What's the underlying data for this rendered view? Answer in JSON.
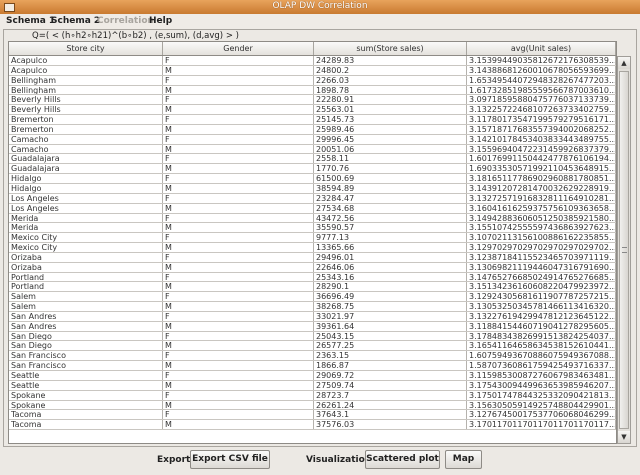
{
  "window": {
    "title": "OLAP DW Correlation"
  },
  "menu": {
    "items": [
      "Schema 1",
      "Schema 2",
      "Correlation",
      "Help"
    ]
  },
  "query": "Q=( < (h∘h2∘h21)^(b∘b2) , (e,sum), (d,avg) > )",
  "table": {
    "columns": [
      "Store city",
      "Gender",
      "sum(Store sales)",
      "avg(Unit sales)"
    ],
    "rows": [
      [
        "Acapulco",
        "F",
        "24289.83",
        "3.15399449035812672176308539..."
      ],
      [
        "Acapulco",
        "M",
        "24800.2",
        "3.14388681260010678056593699..."
      ],
      [
        "Bellingham",
        "F",
        "2266.03",
        "1.65349544072948328267477203..."
      ],
      [
        "Bellingham",
        "M",
        "1898.78",
        "1.61732851985559566787003610..."
      ],
      [
        "Beverly Hills",
        "F",
        "22280.91",
        "3.09718595880475776037133739..."
      ],
      [
        "Beverly Hills",
        "M",
        "25563.01",
        "3.13225722468107263733402759..."
      ],
      [
        "Bremerton",
        "F",
        "25145.73",
        "3.11780173547199579279516171..."
      ],
      [
        "Bremerton",
        "M",
        "25989.46",
        "3.15718717683557394002068252..."
      ],
      [
        "Camacho",
        "F",
        "29996.45",
        "3.14210178453403833443489755..."
      ],
      [
        "Camacho",
        "M",
        "20051.06",
        "3.15596940472231459926837379..."
      ],
      [
        "Guadalajara",
        "F",
        "2558.11",
        "1.60176991150442477876106194..."
      ],
      [
        "Guadalajara",
        "M",
        "1770.76",
        "1.69033530571992110453648915..."
      ],
      [
        "Hidalgo",
        "F",
        "61500.69",
        "3.18165117786902960881780851..."
      ],
      [
        "Hidalgo",
        "M",
        "38594.89",
        "3.14391207281470032629228919..."
      ],
      [
        "Los Angeles",
        "F",
        "23284.47",
        "3.13272571916832811164910281..."
      ],
      [
        "Los Angeles",
        "M",
        "27534.68",
        "3.16041616259375756109363658..."
      ],
      [
        "Merida",
        "F",
        "43472.56",
        "3.14942883606051250385921580..."
      ],
      [
        "Merida",
        "M",
        "35590.57",
        "3.15510742555597436863927623..."
      ],
      [
        "Mexico City",
        "F",
        "9777.13",
        "3.10702113156100886162235855..."
      ],
      [
        "Mexico City",
        "M",
        "13365.66",
        "3.12970297029702970297029702..."
      ],
      [
        "Orizaba",
        "F",
        "29496.01",
        "3.12387184115523465703971119..."
      ],
      [
        "Orizaba",
        "M",
        "22646.06",
        "3.13069821119446047316791690..."
      ],
      [
        "Portland",
        "F",
        "25343.16",
        "3.14765276685024914765276685..."
      ],
      [
        "Portland",
        "M",
        "28290.1",
        "3.15134236160608220479923972..."
      ],
      [
        "Salem",
        "F",
        "36696.49",
        "3.12924305681611907787257215..."
      ],
      [
        "Salem",
        "M",
        "38268.75",
        "3.13053250345781466113416320..."
      ],
      [
        "San Andres",
        "F",
        "33021.97",
        "3.13227619429947812123645122..."
      ],
      [
        "San Andres",
        "M",
        "39361.64",
        "3.11884154460719041278295605..."
      ],
      [
        "San Diego",
        "F",
        "25043.15",
        "3.17848343826991513824254037..."
      ],
      [
        "San Diego",
        "M",
        "26577.25",
        "3.16541164658634538152610441..."
      ],
      [
        "San Francisco",
        "F",
        "2363.15",
        "1.60759493670886075949367088..."
      ],
      [
        "San Francisco",
        "M",
        "1866.87",
        "1.58707360861759425493716337..."
      ],
      [
        "Seattle",
        "F",
        "29069.72",
        "3.11598530087276067983463481..."
      ],
      [
        "Seattle",
        "M",
        "27509.74",
        "3.17543009449963653985946207..."
      ],
      [
        "Spokane",
        "F",
        "28723.7",
        "3.17501747844325332090421813..."
      ],
      [
        "Spokane",
        "M",
        "26261.24",
        "3.15630505914925748804429901..."
      ],
      [
        "Tacoma",
        "F",
        "37643.1",
        "3.12767450017537706068046299..."
      ],
      [
        "Tacoma",
        "M",
        "37576.03",
        "3.17011701170117011701170117..."
      ]
    ]
  },
  "bottom": {
    "export_label": "Export:",
    "export_button": "Export CSV file",
    "visualization_label": "Visualization:",
    "scatter_button": "Scattered plot",
    "map_button": "Map"
  },
  "scrollbar": {
    "up_glyph": "▲",
    "down_glyph": "▼"
  }
}
